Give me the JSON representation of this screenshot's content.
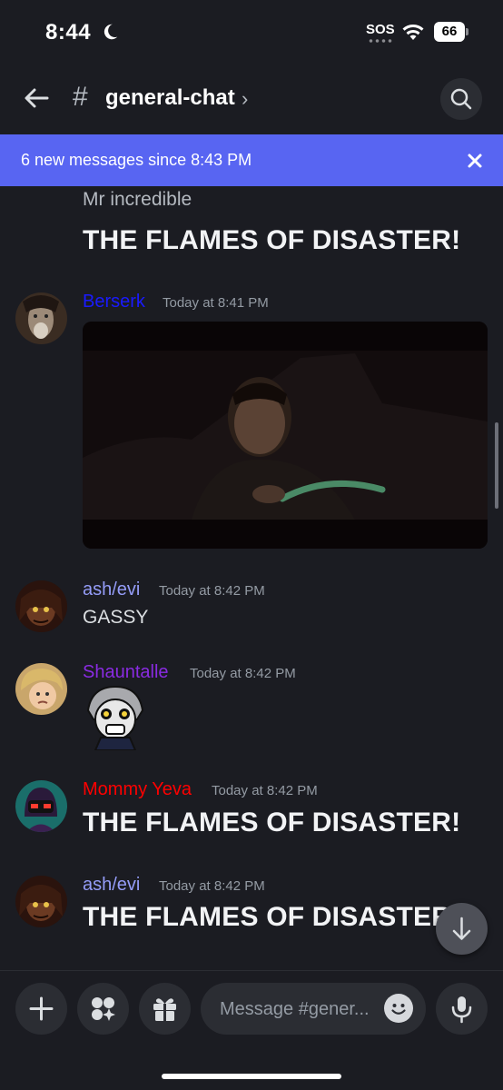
{
  "status_bar": {
    "time": "8:44",
    "sos": "SOS",
    "battery": "66"
  },
  "header": {
    "channel_name": "general-chat",
    "hash": "#",
    "chevron": "›"
  },
  "banner": {
    "text": "6 new messages since 8:43 PM"
  },
  "messages": [
    {
      "author": "Mr incredible",
      "text": "THE FLAMES OF DISASTER!"
    },
    {
      "author": "Berserk",
      "author_color": "#1a1aff",
      "timestamp": "Today at 8:41 PM",
      "attachment": "video"
    },
    {
      "author": "ash/evi",
      "author_color": "#949cf7",
      "timestamp": "Today at 8:42 PM",
      "text": "GASSY"
    },
    {
      "author": "Shauntalle",
      "author_color": "#8a2be2",
      "timestamp": "Today at 8:42 PM",
      "attachment": "sticker"
    },
    {
      "author": "Mommy Yeva",
      "author_color": "#ff0000",
      "timestamp": "Today at 8:42 PM",
      "text": "THE FLAMES OF DISASTER!"
    },
    {
      "author": "ash/evi",
      "author_color": "#949cf7",
      "timestamp": "Today at 8:42 PM",
      "text": "THE FLAMES OF DISASTER!"
    }
  ],
  "composer": {
    "placeholder": "Message #gener..."
  }
}
